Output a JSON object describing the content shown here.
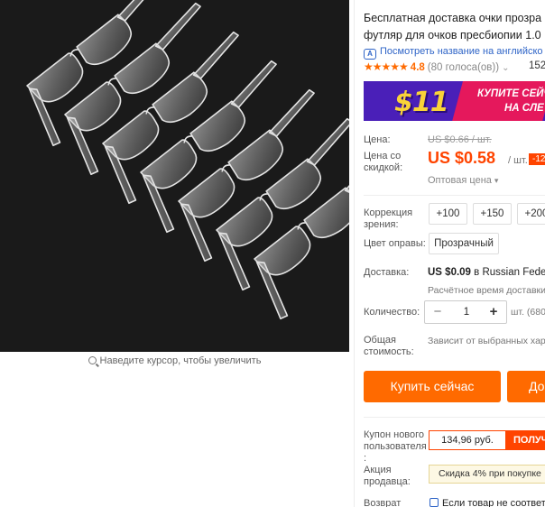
{
  "gallery": {
    "zoom_hint": "Наведите курсор, чтобы увеличить"
  },
  "product": {
    "title_line1": "Бесплатная доставка очки прозра",
    "title_line2": "футляр для очков пресбиопии 1.0",
    "translate_link": "Посмотреть название на английско",
    "translate_icon_text": "A",
    "rating": {
      "stars": "★★★★★",
      "value": "4.8",
      "votes": "(80 голоса(ов))",
      "orders": "152"
    }
  },
  "banner": {
    "amount": "$11",
    "line1": "КУПИТЕ СЕЙЧ",
    "line2": "НА СЛЕ",
    "colors": {
      "background": "#4a1fb8",
      "accent": "#e5185c",
      "amount": "#f9d338"
    }
  },
  "pricing": {
    "price_label": "Цена:",
    "old_price": "US $0.66 / шт.",
    "sale_label_line1": "Цена со",
    "sale_label_line2": "скидкой:",
    "sale_price": "US $0.58",
    "unit": "/ шт.",
    "discount": "-12",
    "wholesale": "Оптовая цена"
  },
  "options": {
    "correction_label_line1": "Коррекция",
    "correction_label_line2": "зрения:",
    "correction_values": [
      "+100",
      "+150",
      "+200"
    ],
    "frame_color_label": "Цвет оправы:",
    "frame_color_value": "Прозрачный"
  },
  "shipping": {
    "label": "Доставка:",
    "price": "US $0.09",
    "destination": "в Russian Federa",
    "estimate": "Расчётное время доставки"
  },
  "quantity": {
    "label": "Количество:",
    "minus": "−",
    "value": "1",
    "plus": "+",
    "available": "шт. (680"
  },
  "total": {
    "label_line1": "Общая",
    "label_line2": "стоимость:",
    "value": "Зависит от выбранных хар"
  },
  "actions": {
    "buy_now": "Купить сейчас",
    "add_to_cart": "До"
  },
  "coupon": {
    "label_line1": "Купон нового",
    "label_line2": "пользователя",
    "label_line3": ":",
    "amount": "134,96 руб.",
    "get": "ПОЛУЧ"
  },
  "seller_promo": {
    "label_line1": "Акция",
    "label_line2": "продавца:",
    "text": "Скидка 4% при покупке"
  },
  "returns": {
    "label": "Возврат",
    "text": "Если товар не соответс"
  },
  "colors": {
    "accent": "#ff6a00",
    "price": "#ff4400",
    "link": "#2e64c7"
  }
}
